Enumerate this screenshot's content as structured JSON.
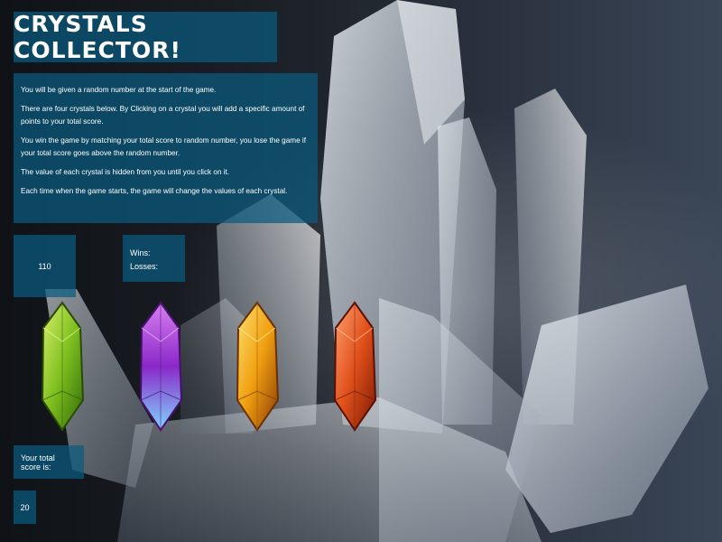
{
  "game": {
    "title": "CRYSTALS COLLECTOR!",
    "instructions": [
      "You will be given a random number at the start of the game.",
      "There are four crystals below. By Clicking on a crystal you will add a specific amount of points to your total score.",
      "You win the game by matching your total score to random number, you lose the game if your total score goes above the random number.",
      "The value of each crystal is hidden from you until you click on it.",
      "Each time when the game starts, the game will change the values of each crystal."
    ],
    "random_number": "110",
    "wins_label": "Wins:",
    "losses_label": "Losses:",
    "total_score_label": "Your total score is:",
    "total_score": "20"
  },
  "crystals": [
    {
      "name": "green-crystal-icon",
      "color": "#7fbf1f"
    },
    {
      "name": "purple-crystal-icon",
      "color": "#b03cd6"
    },
    {
      "name": "yellow-crystal-icon",
      "color": "#f0a010"
    },
    {
      "name": "red-crystal-icon",
      "color": "#e0501a"
    }
  ],
  "colors": {
    "panel": "#0a5c80",
    "text": "#ffffff"
  }
}
